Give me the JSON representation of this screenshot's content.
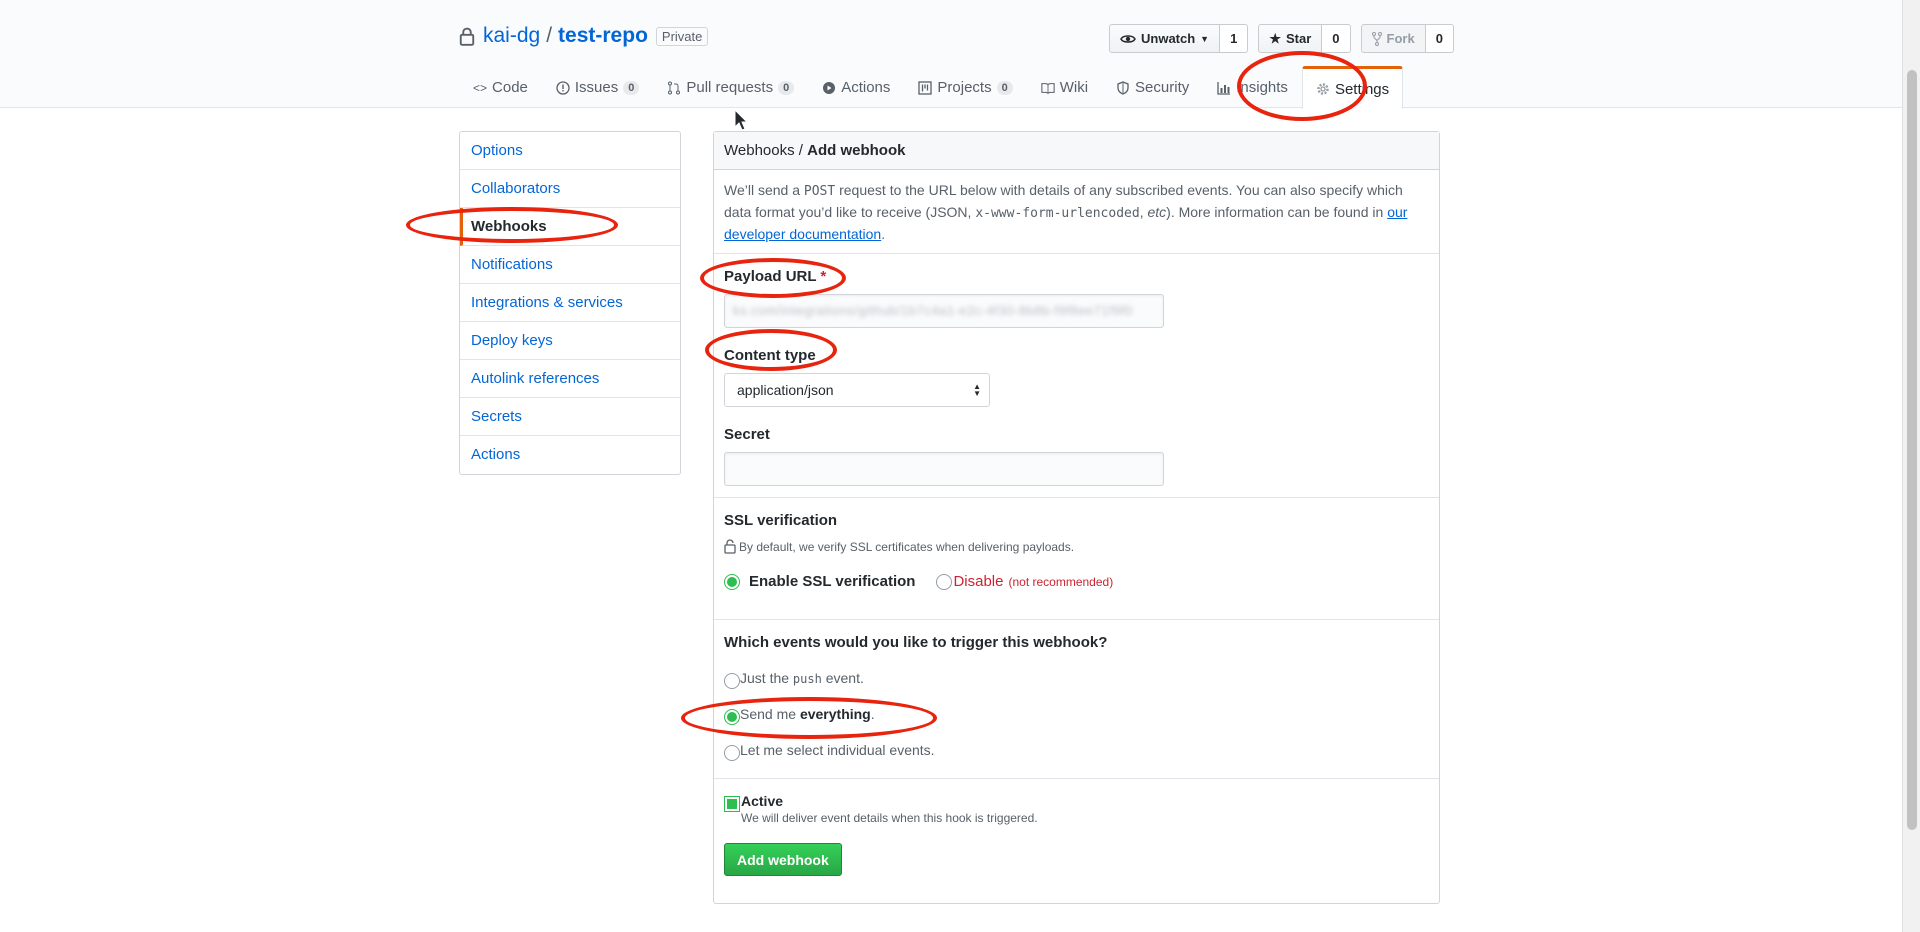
{
  "repo": {
    "owner": "kai-dg",
    "separator": "/",
    "name": "test-repo",
    "visibility": "Private"
  },
  "buttons": {
    "watch": {
      "label": "Unwatch",
      "count": "1"
    },
    "star": {
      "label": "Star",
      "count": "0"
    },
    "fork": {
      "label": "Fork",
      "count": "0"
    }
  },
  "tabs": [
    {
      "label": "Code"
    },
    {
      "label": "Issues",
      "counter": "0"
    },
    {
      "label": "Pull requests",
      "counter": "0"
    },
    {
      "label": "Actions"
    },
    {
      "label": "Projects",
      "counter": "0"
    },
    {
      "label": "Wiki"
    },
    {
      "label": "Security"
    },
    {
      "label": "Insights"
    },
    {
      "label": "Settings"
    }
  ],
  "sidebar": {
    "items": [
      {
        "label": "Options"
      },
      {
        "label": "Collaborators"
      },
      {
        "label": "Webhooks"
      },
      {
        "label": "Notifications"
      },
      {
        "label": "Integrations & services"
      },
      {
        "label": "Deploy keys"
      },
      {
        "label": "Autolink references"
      },
      {
        "label": "Secrets"
      },
      {
        "label": "Actions"
      }
    ]
  },
  "breadcrumb": {
    "parent": "Webhooks",
    "separator": " / ",
    "current": "Add webhook"
  },
  "intro": {
    "p1": "We’ll send a ",
    "post": "POST",
    "p2": " request to the URL below with details of any subscribed events. You can also specify which data format you’d like to receive (JSON, ",
    "format": "x-www-form-urlencoded",
    "p3": ", ",
    "etc": "etc",
    "p4": "). More information can be found in ",
    "link": "our developer documentation",
    "p5": "."
  },
  "form": {
    "payload_label": "Payload URL",
    "required_mark": "*",
    "payload_value": "ks.com/integrations/github/1b7c4a1-e2c-4f30-8b8b-f9f8ee71f9f0",
    "content_type_label": "Content type",
    "content_type_value": "application/json",
    "secret_label": "Secret",
    "secret_value": ""
  },
  "ssl": {
    "heading": "SSL verification",
    "description": "By default, we verify SSL certificates when delivering payloads.",
    "enable_label": "Enable SSL verification",
    "disable_label": "Disable",
    "disable_note": "(not recommended)"
  },
  "events": {
    "question": "Which events would you like to trigger this webhook?",
    "opt1_a": "Just the ",
    "opt1_code": "push",
    "opt1_b": " event.",
    "opt2_a": "Send me ",
    "opt2_b": "everything",
    "opt2_c": ".",
    "opt3": "Let me select individual events."
  },
  "active": {
    "label": "Active",
    "description": "We will deliver event details when this hook is triggered."
  },
  "submit_label": "Add webhook",
  "colors": {
    "annotation": "#e8230e",
    "link": "#0366d6",
    "accent": "#e36209",
    "primary": "#28a745"
  }
}
